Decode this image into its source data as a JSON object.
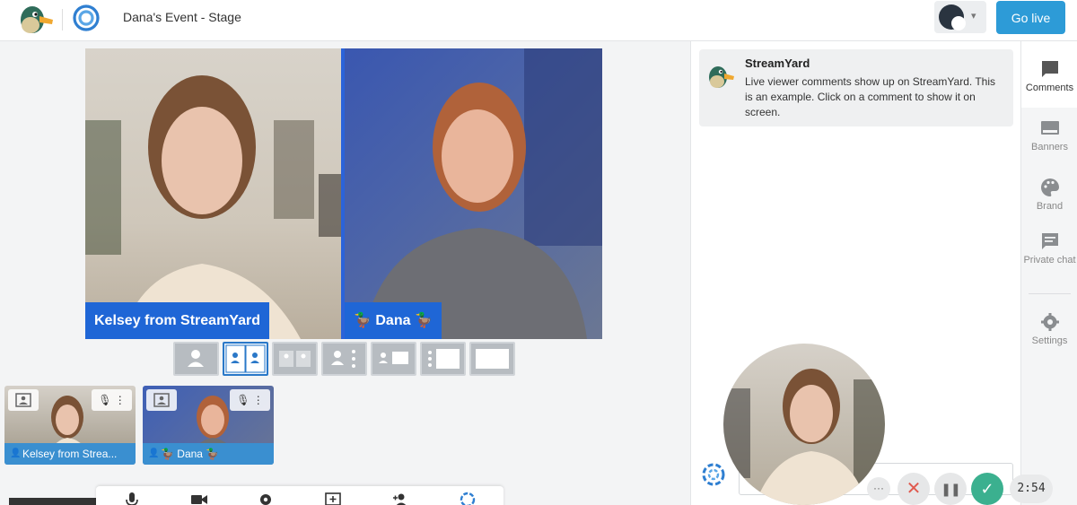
{
  "header": {
    "event_title": "Dana's Event - Stage",
    "go_live_label": "Go live"
  },
  "stage": {
    "participants": [
      {
        "name": "Kelsey from StreamYard"
      },
      {
        "name": "🦆 Dana 🦆"
      }
    ]
  },
  "backstage": {
    "thumbnails": [
      {
        "name": "Kelsey from Strea..."
      },
      {
        "name": "🦆 Dana 🦆"
      }
    ]
  },
  "comments": [
    {
      "author": "StreamYard",
      "text": "Live viewer comments show up on StreamYard. This is an example. Click on a comment to show it on screen."
    }
  ],
  "sidebar": {
    "items": [
      {
        "label": "Comments",
        "icon": "comments-icon"
      },
      {
        "label": "Banners",
        "icon": "banners-icon"
      },
      {
        "label": "Brand",
        "icon": "palette-icon"
      },
      {
        "label": "Private chat",
        "icon": "private-chat-icon"
      },
      {
        "label": "Settings",
        "icon": "gear-icon"
      }
    ]
  },
  "actions": {
    "more_label": "···",
    "timer": "2:54"
  },
  "colors": {
    "accent": "#2d9bd7",
    "name_tag": "#1f66d6",
    "approve": "#3bb08f",
    "reject": "#e05a4f"
  }
}
